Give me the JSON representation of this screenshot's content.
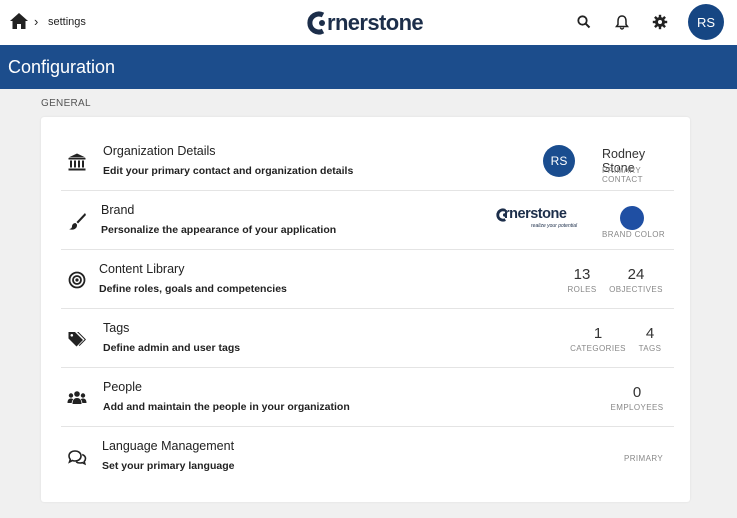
{
  "header": {
    "breadcrumb": "settings",
    "breadcrumb_sep": "›",
    "logo_text": "rnerstone",
    "user_initials": "RS"
  },
  "band": {
    "title": "Configuration"
  },
  "section": {
    "label": "GENERAL"
  },
  "rows": [
    {
      "icon": "institution-icon",
      "title": "Organization Details",
      "subtitle": "Edit your primary contact and organization details",
      "contact": {
        "initials": "RS",
        "name": "Rodney Stone",
        "label": "PRIMARY CONTACT"
      }
    },
    {
      "icon": "paintbrush-icon",
      "title": "Brand",
      "subtitle": "Personalize the appearance of your application",
      "brand": {
        "logo_text": "rnerstone",
        "tagline": "realize your potential",
        "color": "#1f4fa3",
        "color_label": "BRAND COLOR"
      }
    },
    {
      "icon": "target-icon",
      "title": "Content Library",
      "subtitle": "Define roles, goals and competencies",
      "stats": [
        {
          "value": "13",
          "label": "ROLES"
        },
        {
          "value": "24",
          "label": "OBJECTIVES"
        }
      ]
    },
    {
      "icon": "tags-icon",
      "title": "Tags",
      "subtitle": "Define admin and user tags",
      "stats": [
        {
          "value": "1",
          "label": "CATEGORIES"
        },
        {
          "value": "4",
          "label": "TAGS"
        }
      ]
    },
    {
      "icon": "people-icon",
      "title": "People",
      "subtitle": "Add and maintain the people in your organization",
      "stats": [
        {
          "value": "0",
          "label": "EMPLOYEES"
        }
      ]
    },
    {
      "icon": "chat-bubbles-icon",
      "title": "Language Management",
      "subtitle": "Set your primary language",
      "label": "PRIMARY"
    }
  ],
  "colors": {
    "accent": "#1c4d8c",
    "avatar": "#164683",
    "brand": "#1f4fa3"
  }
}
